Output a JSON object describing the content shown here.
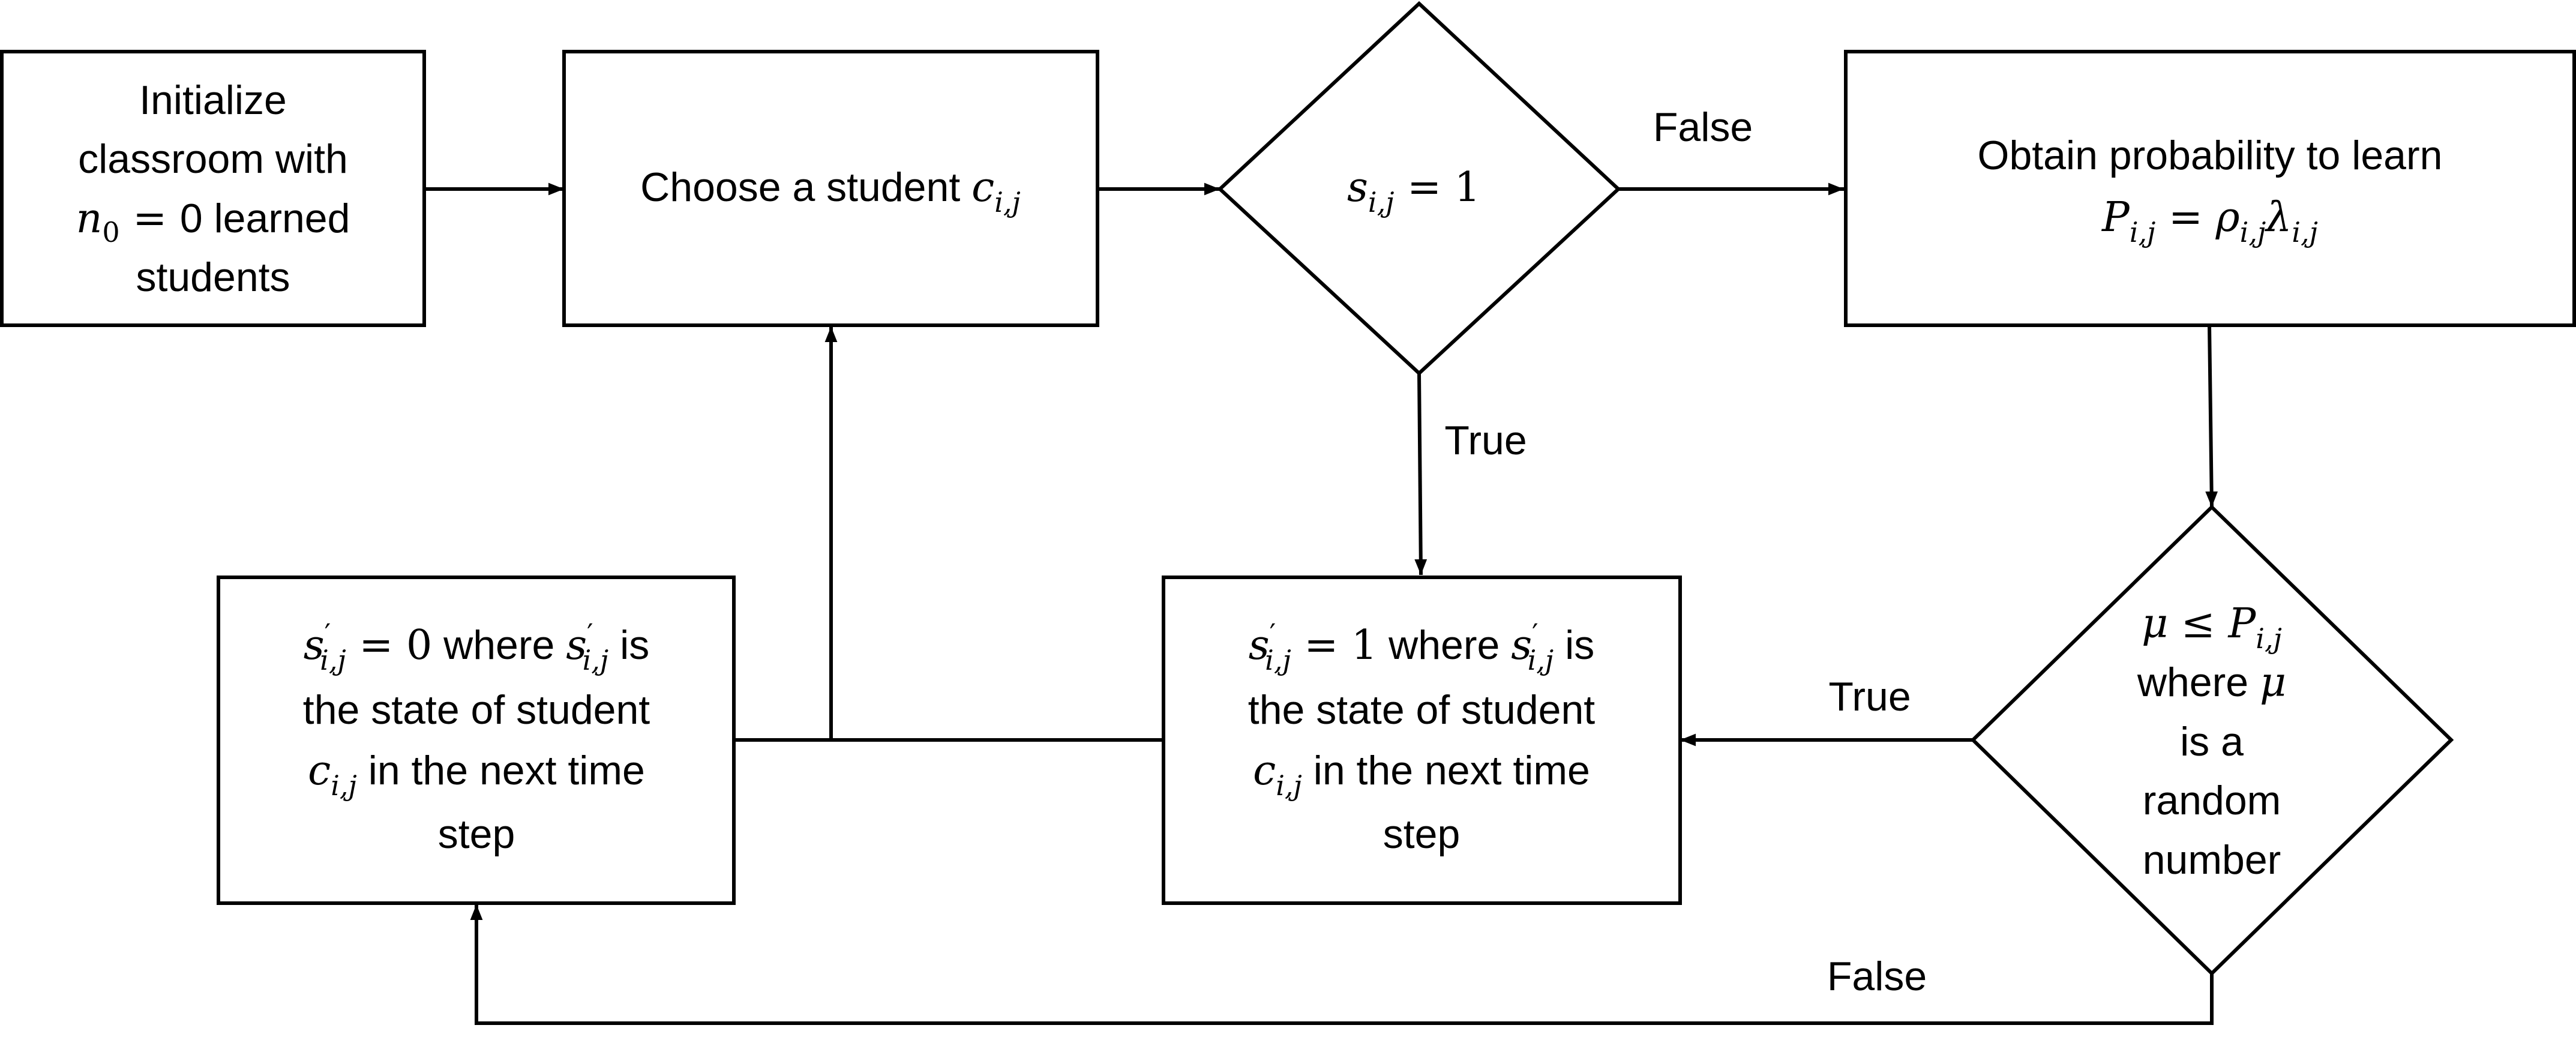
{
  "nodes": {
    "init": {
      "lines": [
        "Initialize",
        "classroom with",
        "0 learned",
        "students"
      ],
      "math_n0": "n",
      "math_n0_sub": "0",
      "math_eq": " = "
    },
    "choose": {
      "text": "Choose a student ",
      "math_c": "c",
      "math_sub": "i,j"
    },
    "decision1": {
      "math_s": "s",
      "math_sub": "i,j",
      "math_rhs": " = 1"
    },
    "obtain": {
      "line1": "Obtain probability to learn",
      "math_P": "P",
      "math_sub": "i,j",
      "math_eq": " = ",
      "math_rho": "ρ",
      "math_lambda": "λ"
    },
    "state_one": {
      "math_s": "s",
      "prime": "′",
      "math_sub": "i,j",
      "math_rhs": " = 1",
      "text1": " where ",
      "text1b": " is",
      "line2": "the state of student",
      "math_c": "c",
      "text3": " in the next time",
      "line4": "step"
    },
    "state_zero": {
      "math_s": "s",
      "prime": "′",
      "math_sub": "i,j",
      "math_rhs": " = 0",
      "text1": " where ",
      "text1b": " is",
      "line2": "the state of student",
      "math_c": "c",
      "text3": " in the next time",
      "line4": "step"
    },
    "decision2": {
      "math_mu": "μ",
      "math_le": " ≤ ",
      "math_P": "P",
      "math_sub": "i,j",
      "line2": "where ",
      "line3": "is a",
      "line4": "random",
      "line5": "number"
    }
  },
  "edge_labels": {
    "d1_false": "False",
    "d1_true": "True",
    "d2_true": "True",
    "d2_false": "False"
  }
}
